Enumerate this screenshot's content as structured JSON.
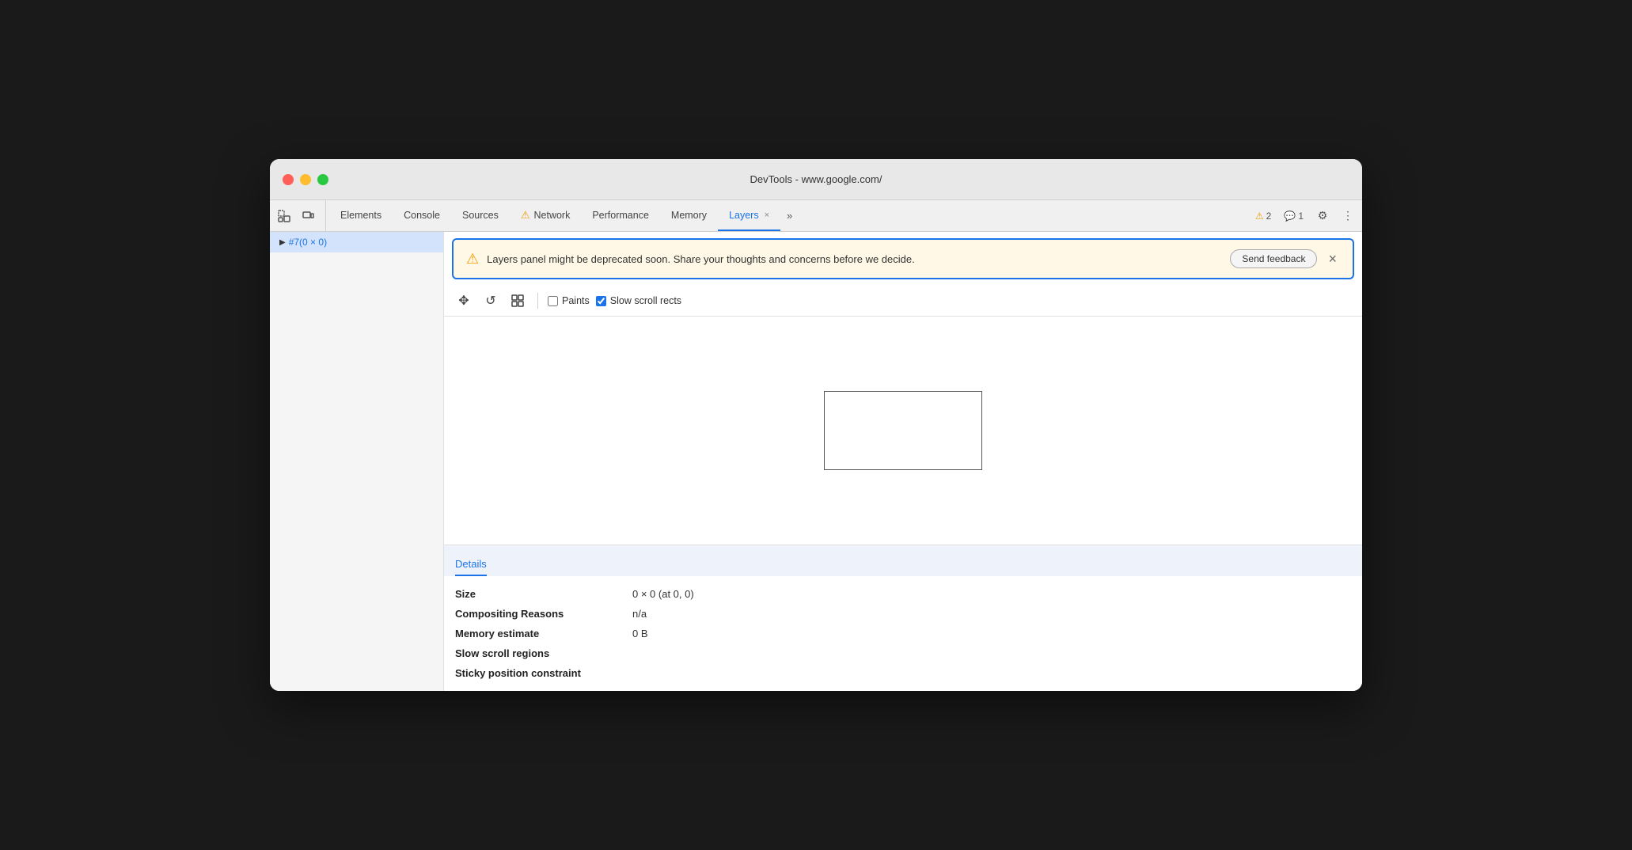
{
  "window": {
    "title": "DevTools - www.google.com/"
  },
  "tabs": {
    "items": [
      {
        "id": "elements",
        "label": "Elements",
        "active": false,
        "has_warning": false,
        "closable": false
      },
      {
        "id": "console",
        "label": "Console",
        "active": false,
        "has_warning": false,
        "closable": false
      },
      {
        "id": "sources",
        "label": "Sources",
        "active": false,
        "has_warning": false,
        "closable": false
      },
      {
        "id": "network",
        "label": "Network",
        "active": false,
        "has_warning": true,
        "closable": false
      },
      {
        "id": "performance",
        "label": "Performance",
        "active": false,
        "has_warning": false,
        "closable": false
      },
      {
        "id": "memory",
        "label": "Memory",
        "active": false,
        "has_warning": false,
        "closable": false
      },
      {
        "id": "layers",
        "label": "Layers",
        "active": true,
        "has_warning": false,
        "closable": true
      }
    ],
    "more_label": "»",
    "warnings_count": "2",
    "messages_count": "1"
  },
  "sidebar": {
    "selected_item": "#7(0 × 0)"
  },
  "banner": {
    "warning_icon": "⚠",
    "message": "Layers panel might be deprecated soon. Share your thoughts and concerns before we decide.",
    "send_feedback_label": "Send feedback",
    "close_icon": "×"
  },
  "toolbar": {
    "move_icon": "✥",
    "rotate_icon": "↺",
    "fit_icon": "⊞",
    "paints_label": "Paints",
    "slow_scroll_label": "Slow scroll rects",
    "paints_checked": false,
    "slow_scroll_checked": true
  },
  "details": {
    "tab_label": "Details",
    "rows": [
      {
        "key": "Size",
        "value": "0 × 0 (at 0, 0)"
      },
      {
        "key": "Compositing Reasons",
        "value": "n/a"
      },
      {
        "key": "Memory estimate",
        "value": "0 B"
      },
      {
        "key": "Slow scroll regions",
        "value": ""
      },
      {
        "key": "Sticky position constraint",
        "value": ""
      }
    ]
  }
}
